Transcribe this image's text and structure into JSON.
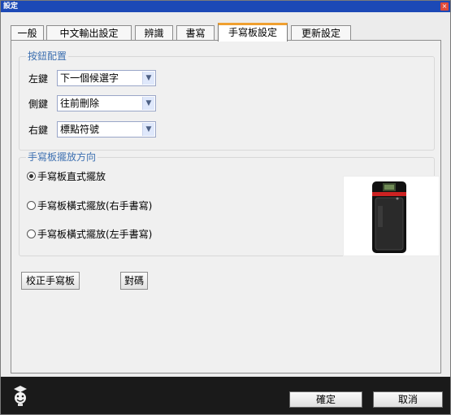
{
  "window": {
    "title": "設定",
    "close_glyph": "×"
  },
  "tabs": [
    {
      "label": "一般"
    },
    {
      "label": "中文輸出設定"
    },
    {
      "label": "辨識"
    },
    {
      "label": "書寫"
    },
    {
      "label": "手寫板設定",
      "active": true
    },
    {
      "label": "更新設定"
    }
  ],
  "button_config": {
    "title": "按鈕配置",
    "rows": [
      {
        "label": "左鍵",
        "value": "下一個候選字"
      },
      {
        "label": "側鍵",
        "value": "往前刪除"
      },
      {
        "label": "右鍵",
        "value": "標點符號"
      }
    ]
  },
  "orientation": {
    "title": "手寫板擺放方向",
    "options": [
      {
        "label": "手寫板直式擺放",
        "selected": true
      },
      {
        "label": "手寫板橫式擺放(右手書寫)",
        "selected": false
      },
      {
        "label": "手寫板橫式擺放(左手書寫)",
        "selected": false
      }
    ],
    "device_image": "tablet-device-image"
  },
  "actions": {
    "calibrate": "校正手寫板",
    "pair": "對碼"
  },
  "footer": {
    "confirm": "確定",
    "cancel": "取消",
    "logo": "penpower-logo-icon"
  },
  "colors": {
    "titlebar": "#1c49b6",
    "group_title": "#3c6fb0",
    "active_tab_accent": "#f0a030",
    "footer": "#1a1a1a"
  }
}
